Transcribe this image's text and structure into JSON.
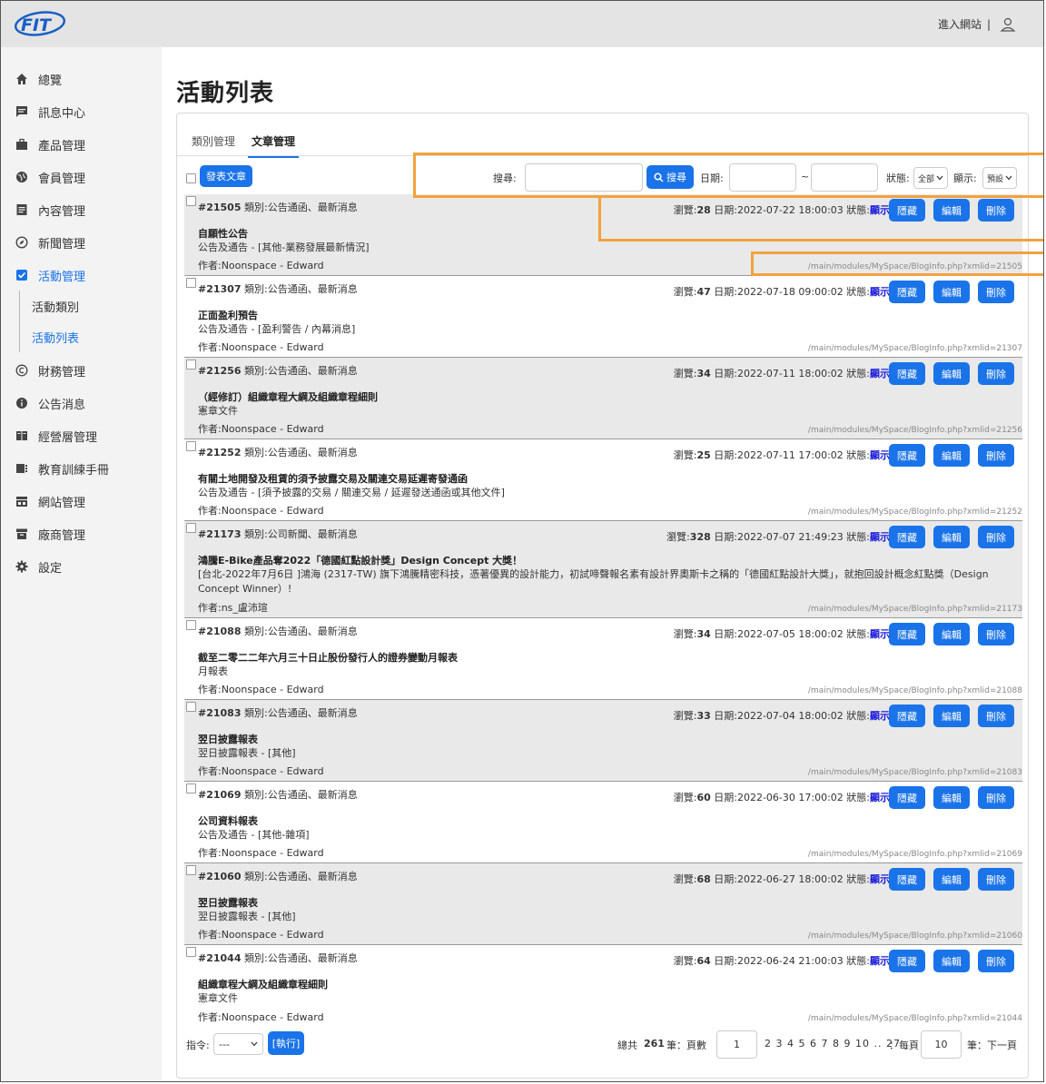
{
  "header": {
    "enter_site": "進入網站",
    "separator": "|"
  },
  "sidebar": {
    "items": [
      {
        "label": "總覽",
        "icon": "home-icon"
      },
      {
        "label": "訊息中心",
        "icon": "message-icon"
      },
      {
        "label": "產品管理",
        "icon": "briefcase-icon"
      },
      {
        "label": "會員管理",
        "icon": "globe-icon"
      },
      {
        "label": "內容管理",
        "icon": "document-icon"
      },
      {
        "label": "新聞管理",
        "icon": "compass-icon"
      },
      {
        "label": "活動管理",
        "icon": "checkbox-icon"
      },
      {
        "label": "財務管理",
        "icon": "copyright-icon"
      },
      {
        "label": "公告消息",
        "icon": "info-icon"
      },
      {
        "label": "經營層管理",
        "icon": "book-icon"
      },
      {
        "label": "教育訓練手冊",
        "icon": "list-icon"
      },
      {
        "label": "網站管理",
        "icon": "site-icon"
      },
      {
        "label": "廠商管理",
        "icon": "archive-icon"
      },
      {
        "label": "設定",
        "icon": "gear-icon"
      }
    ],
    "sub_items": [
      {
        "label": "活動類別"
      },
      {
        "label": "活動列表"
      }
    ]
  },
  "page": {
    "title": "活動列表"
  },
  "tabs": [
    {
      "label": "類別管理"
    },
    {
      "label": "文章管理"
    }
  ],
  "toolbar": {
    "post_button": "發表文章",
    "search_label": "搜尋:",
    "search_button": "搜尋",
    "date_label": "日期:",
    "tilde": "~",
    "status_label": "狀態:",
    "status_value": "全部",
    "display_label": "顯示:",
    "display_value": "預設"
  },
  "row_labels": {
    "hide": "隱藏",
    "edit": "編輯",
    "delete": "刪除",
    "visible": "顯示"
  },
  "articles": [
    {
      "id": "#21505",
      "category": "類別:公告通函、最新消息",
      "views": "28",
      "date": "2022-07-22 18:00:03",
      "title": "自願性公告",
      "desc": "公告及通告 - [其他-業務發展最新情況]",
      "author": "作者:Noonspace - Edward",
      "url": "/main/modules/MySpace/BlogInfo.php?xmlid=21505"
    },
    {
      "id": "#21307",
      "category": "類別:公告通函、最新消息",
      "views": "47",
      "date": "2022-07-18 09:00:02",
      "title": "正面盈利預告",
      "desc": "公告及通告 - [盈利警告 / 內幕消息]",
      "author": "作者:Noonspace - Edward",
      "url": "/main/modules/MySpace/BlogInfo.php?xmlid=21307"
    },
    {
      "id": "#21256",
      "category": "類別:公告通函、最新消息",
      "views": "34",
      "date": "2022-07-11 18:00:02",
      "title": "（經修訂）組織章程大綱及組織章程細則",
      "desc": "憲章文件",
      "author": "作者:Noonspace - Edward",
      "url": "/main/modules/MySpace/BlogInfo.php?xmlid=21256"
    },
    {
      "id": "#21252",
      "category": "類別:公告通函、最新消息",
      "views": "25",
      "date": "2022-07-11 17:00:02",
      "title": "有關土地開發及租賃的須予披露交易及關連交易延遲寄發通函",
      "desc": "公告及通告 - [須予披露的交易 / 關連交易 / 延遲發送通函或其他文件]",
      "author": "作者:Noonspace - Edward",
      "url": "/main/modules/MySpace/BlogInfo.php?xmlid=21252"
    },
    {
      "id": "#21173",
      "category": "類別:公司新聞、最新消息",
      "views": "328",
      "date": "2022-07-07 21:49:23",
      "title": "鴻騰E-Bike產品奪2022「德國紅點設計獎」Design Concept 大獎！",
      "desc": "[台北-2022年7月6日 ]鴻海 (2317-TW) 旗下鴻騰精密科技，憑著優異的設計能力，初試啼聲報名素有設計界奧斯卡之稱的「德國紅點設計大獎」，就抱回設計概念紅點獎（Design Concept Winner）!",
      "author": "作者:ns_盧沛瑄",
      "url": "/main/modules/MySpace/BlogInfo.php?xmlid=21173"
    },
    {
      "id": "#21088",
      "category": "類別:公告通函、最新消息",
      "views": "34",
      "date": "2022-07-05 18:00:02",
      "title": "截至二零二二年六月三十日止股份發行人的證券變動月報表",
      "desc": "月報表",
      "author": "作者:Noonspace - Edward",
      "url": "/main/modules/MySpace/BlogInfo.php?xmlid=21088"
    },
    {
      "id": "#21083",
      "category": "類別:公告通函、最新消息",
      "views": "33",
      "date": "2022-07-04 18:00:02",
      "title": "翌日披露報表",
      "desc": "翌日披露報表 - [其他]",
      "author": "作者:Noonspace - Edward",
      "url": "/main/modules/MySpace/BlogInfo.php?xmlid=21083"
    },
    {
      "id": "#21069",
      "category": "類別:公告通函、最新消息",
      "views": "60",
      "date": "2022-06-30 17:00:02",
      "title": "公司資料報表",
      "desc": "公告及通告 - [其他-雜項]",
      "author": "作者:Noonspace - Edward",
      "url": "/main/modules/MySpace/BlogInfo.php?xmlid=21069"
    },
    {
      "id": "#21060",
      "category": "類別:公告通函、最新消息",
      "views": "68",
      "date": "2022-06-27 18:00:02",
      "title": "翌日披露報表",
      "desc": "翌日披露報表 - [其他]",
      "author": "作者:Noonspace - Edward",
      "url": "/main/modules/MySpace/BlogInfo.php?xmlid=21060"
    },
    {
      "id": "#21044",
      "category": "類別:公告通函、最新消息",
      "views": "64",
      "date": "2022-06-24 21:00:03",
      "title": "組織章程大綱及組織章程細則",
      "desc": "憲章文件",
      "author": "作者:Noonspace - Edward",
      "url": "/main/modules/MySpace/BlogInfo.php?xmlid=21044"
    }
  ],
  "footer": {
    "command_label": "指令:",
    "command_value": "---",
    "execute_button": "[執行]",
    "total_prefix": "總共",
    "total": "261",
    "total_suffix": "筆：頁數",
    "page_value": "1",
    "pages": "2 3 4 5 6 7 8 9 10 .. 27",
    "per_page_label": "：每頁",
    "per_page_value": "10",
    "next_label": "筆：下一頁"
  },
  "colors": {
    "accent": "#1a73e8",
    "highlight": "#f2a23c",
    "visible": "#1a1adb"
  }
}
